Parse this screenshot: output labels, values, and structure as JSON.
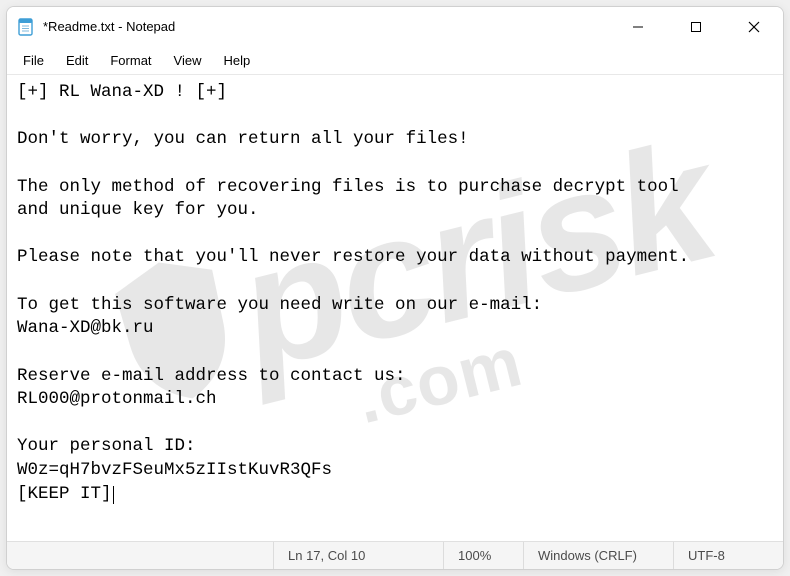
{
  "window": {
    "title": "*Readme.txt - Notepad"
  },
  "menu": {
    "file": "File",
    "edit": "Edit",
    "format": "Format",
    "view": "View",
    "help": "Help"
  },
  "document": {
    "text": "[+] RL Wana-XD ! [+]\n\nDon't worry, you can return all your files!\n\nThe only method of recovering files is to purchase decrypt tool\nand unique key for you.\n\nPlease note that you'll never restore your data without payment.\n\nTo get this software you need write on our e-mail:\nWana-XD@bk.ru\n\nReserve e-mail address to contact us:\nRL000@protonmail.ch\n\nYour personal ID:\nW0z=qH7bvzFSeuMx5zIIstKuvR3QFs\n[KEEP IT]"
  },
  "status": {
    "position": "Ln 17, Col 10",
    "zoom": "100%",
    "eol": "Windows (CRLF)",
    "encoding": "UTF-8"
  },
  "watermark": {
    "brand": "pcrisk",
    "suffix": ".com"
  }
}
